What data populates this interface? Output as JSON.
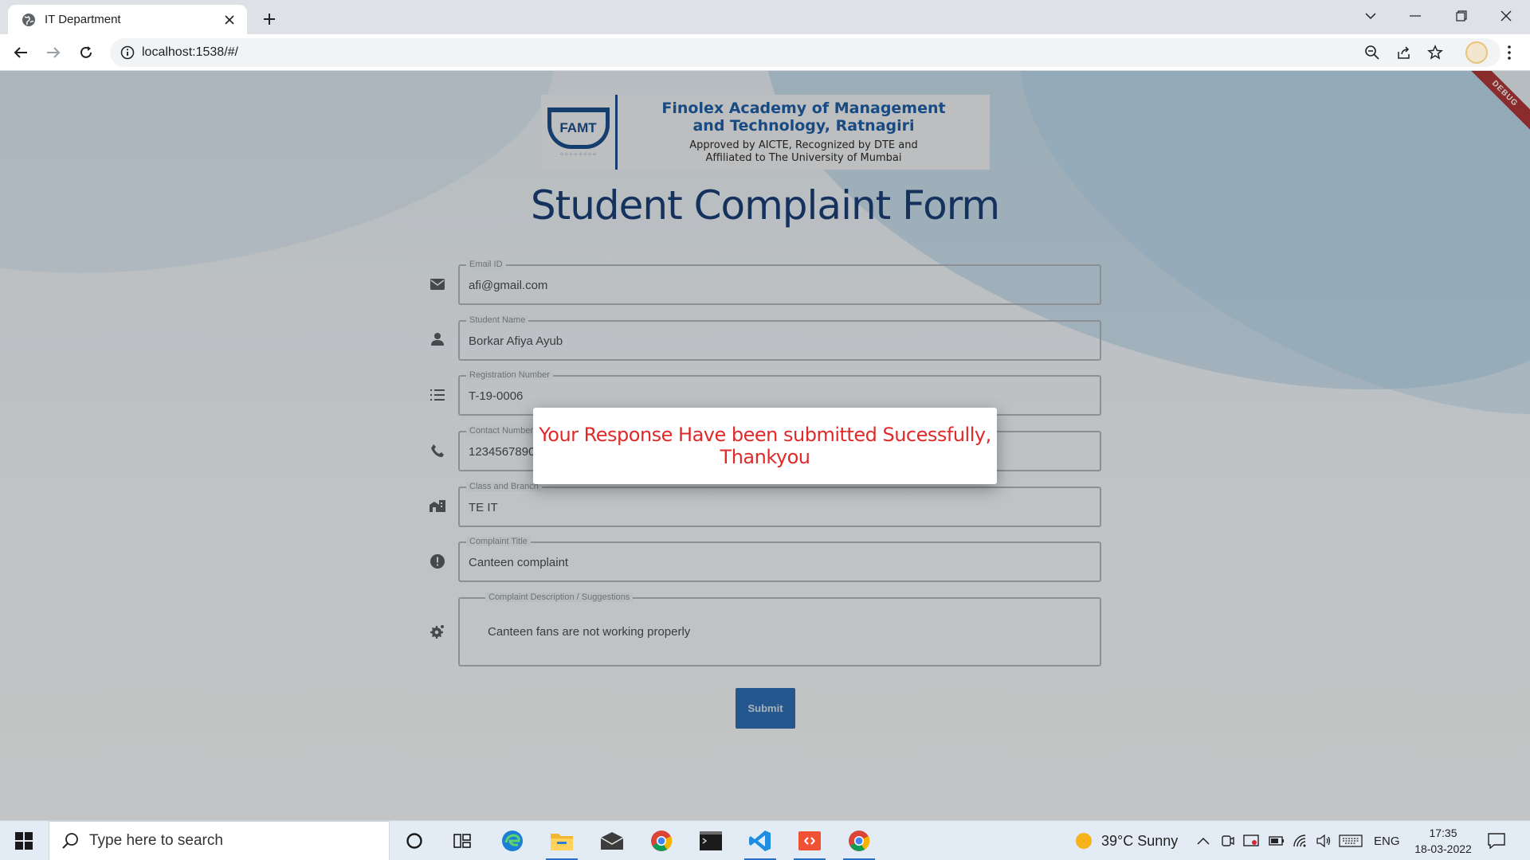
{
  "browser": {
    "tab_title": "IT Department",
    "url": "localhost:1538/#/"
  },
  "page": {
    "debug_ribbon": "DEBUG",
    "logo": {
      "emblem_text": "FAMT",
      "line1": "Finolex Academy of Management",
      "line2": "and Technology, Ratnagiri",
      "line3": "Approved by AICTE, Recognized by DTE and",
      "line4": "Affiliated to The University of Mumbai"
    },
    "title": "Student Complaint Form",
    "fields": {
      "email": {
        "label": "Email ID",
        "value": "afi@gmail.com",
        "icon": "mail-icon"
      },
      "name": {
        "label": "Student Name",
        "value": "Borkar Afiya Ayub",
        "icon": "person-icon"
      },
      "registration": {
        "label": "Registration Number",
        "value": "T-19-0006",
        "icon": "list-icon"
      },
      "contact": {
        "label": "Contact Number",
        "value": "1234567890",
        "icon": "phone-icon"
      },
      "class_branch": {
        "label": "Class and Branch",
        "value": "TE IT",
        "icon": "building-icon"
      },
      "complaint_title": {
        "label": "Complaint Title",
        "value": "Canteen complaint",
        "icon": "alert-icon"
      },
      "description": {
        "label": "Complaint Description / Suggestions",
        "value": "Canteen fans are not working properly",
        "icon": "settings-icon"
      }
    },
    "submit_label": "Submit",
    "dialog": {
      "line1": "Your Response Have been submitted Sucessfully,",
      "line2": "Thankyou"
    }
  },
  "taskbar": {
    "search_placeholder": "Type here to search",
    "weather": "39°C  Sunny",
    "language": "ENG",
    "time": "17:35",
    "date": "18-03-2022"
  },
  "colors": {
    "title": "#1b3f78",
    "dialog_text": "#e02a2a",
    "submit": "#2f70b6"
  }
}
